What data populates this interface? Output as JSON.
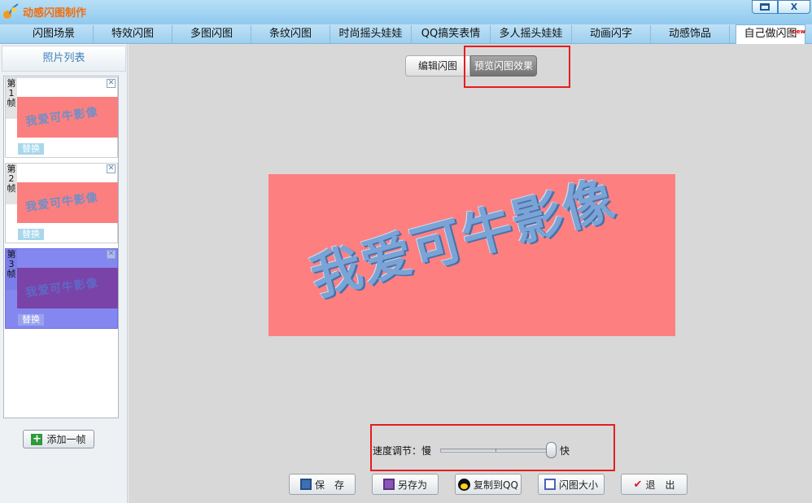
{
  "app": {
    "title": "动感闪图制作"
  },
  "window": {
    "maximize_icon": "maximize-icon",
    "close_label": "X"
  },
  "tabs": [
    {
      "label": "闪图场景"
    },
    {
      "label": "特效闪图"
    },
    {
      "label": "多图闪图"
    },
    {
      "label": "条纹闪图"
    },
    {
      "label": "时尚摇头娃娃"
    },
    {
      "label": "QQ搞笑表情"
    },
    {
      "label": "多人摇头娃娃"
    },
    {
      "label": "动画闪字"
    },
    {
      "label": "动感饰品"
    },
    {
      "label": "自己做闪图",
      "badge": "new"
    }
  ],
  "sidebar": {
    "header": "照片列表",
    "frames": [
      {
        "label": "第1帧",
        "replace": "替换",
        "caption": "我爱可牛影像"
      },
      {
        "label": "第2帧",
        "replace": "替换",
        "caption": "我爱可牛影像"
      },
      {
        "label": "第3帧",
        "replace": "替换",
        "caption": "我爱可牛影像"
      }
    ],
    "add_frame": "添加一帧"
  },
  "mode": {
    "edit": "编辑闪图",
    "preview": "预览闪图效果"
  },
  "preview": {
    "caption": "我爱可牛影像"
  },
  "speed": {
    "label": "速度调节：慢",
    "fast": "快",
    "value": 0.95
  },
  "buttons": {
    "save": "保　存",
    "save_as": "另存为",
    "copy_qq": "复制到QQ",
    "size": "闪图大小",
    "exit": "退　出"
  },
  "colors": {
    "accent": "#e41e1e",
    "preview_bg": "#fd7f80",
    "selected_frame": "#8587f0",
    "title_text": "#f06e10"
  }
}
